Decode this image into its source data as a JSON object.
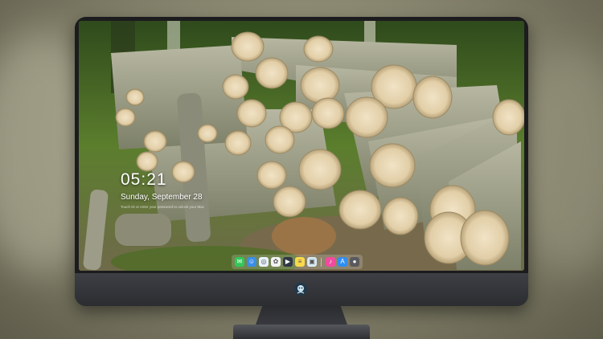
{
  "lock_screen": {
    "time": "05:21",
    "date": "Sunday, September 28",
    "hint": "Touch ID or enter your password to unlock your Mac"
  },
  "dock": {
    "apps": [
      {
        "name": "messages-icon",
        "color": "#34c759",
        "glyph": "✉"
      },
      {
        "name": "finder-icon",
        "color": "#3a8ee6",
        "glyph": "☺"
      },
      {
        "name": "safari-icon",
        "color": "#e8f2ff",
        "glyph": "◎"
      },
      {
        "name": "photos-icon",
        "color": "#f2f2f2",
        "glyph": "✿"
      },
      {
        "name": "claquette-icon",
        "color": "#303846",
        "glyph": "▶"
      },
      {
        "name": "notes-icon",
        "color": "#f9d94a",
        "glyph": "≡"
      },
      {
        "name": "preview-icon",
        "color": "#d8e8f0",
        "glyph": "▣"
      },
      {
        "name": "itunes-icon",
        "color": "#f24a9e",
        "glyph": "♪"
      },
      {
        "name": "app-store-icon",
        "color": "#2f8ef0",
        "glyph": "A"
      },
      {
        "name": "camera-icon",
        "color": "#5a5a5e",
        "glyph": "●"
      }
    ]
  },
  "colors": {
    "bezel": "#1c1c1e",
    "chin": "#3d3f44",
    "wallpaper_grass": "#4a6a2a"
  }
}
